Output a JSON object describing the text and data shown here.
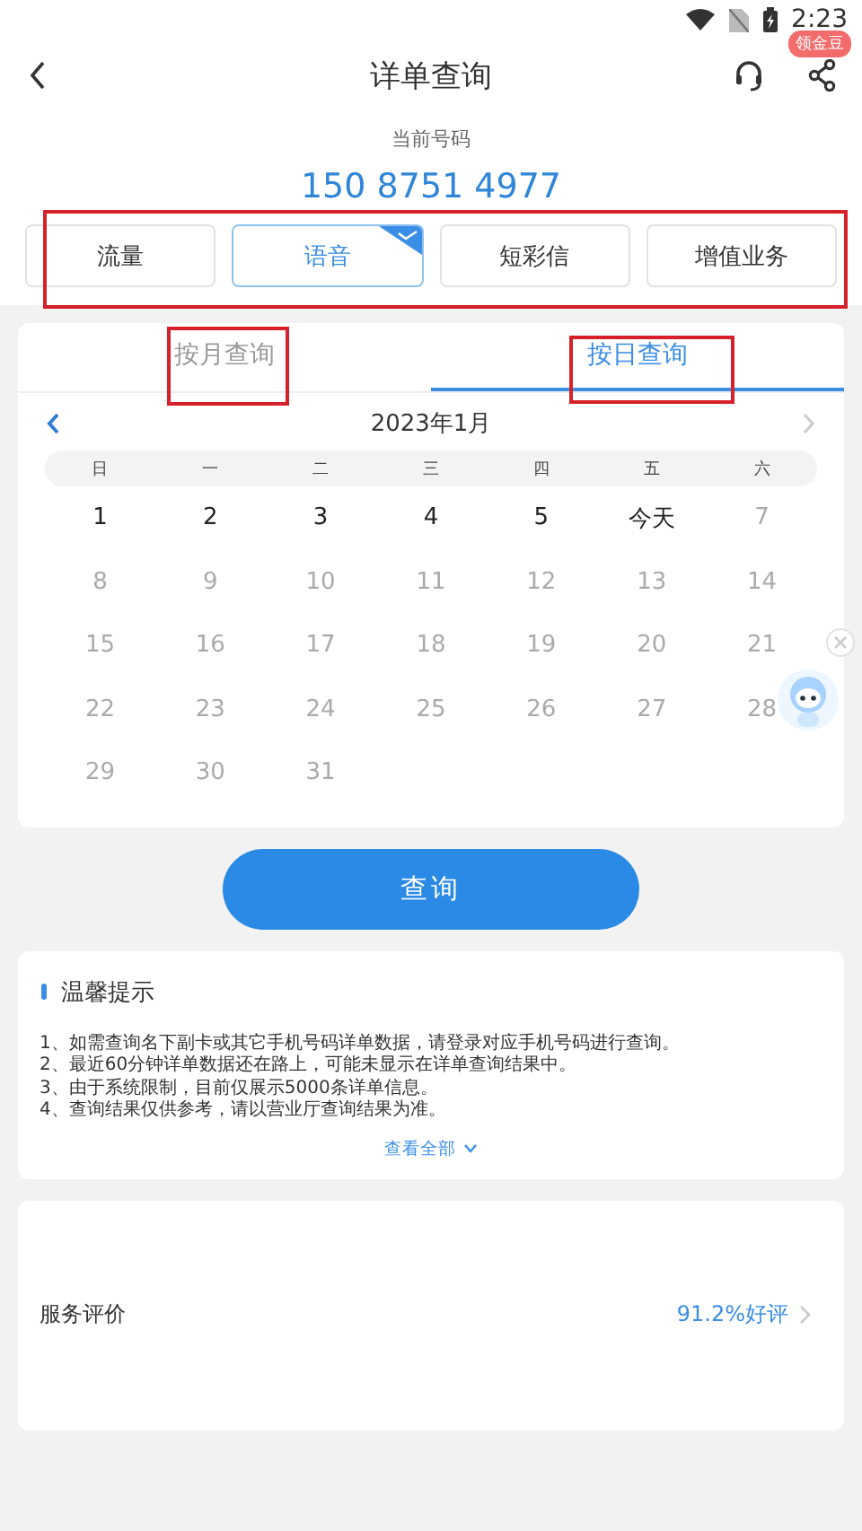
{
  "status_bar": {
    "time": "2:23"
  },
  "header": {
    "title": "详单查询",
    "badge": "领金豆"
  },
  "number_label": "当前号码",
  "phone_number": "150 8751 4977",
  "categories": [
    {
      "label": "流量",
      "selected": false
    },
    {
      "label": "语音",
      "selected": true
    },
    {
      "label": "短彩信",
      "selected": false
    },
    {
      "label": "增值业务",
      "selected": false
    }
  ],
  "query_tabs": [
    {
      "label": "按月查询",
      "selected": false
    },
    {
      "label": "按日查询",
      "selected": true
    }
  ],
  "calendar": {
    "month": "2023年1月",
    "weekdays": [
      "日",
      "一",
      "二",
      "三",
      "四",
      "五",
      "六"
    ],
    "days": [
      {
        "label": "1",
        "disabled": false
      },
      {
        "label": "2",
        "disabled": false
      },
      {
        "label": "3",
        "disabled": false
      },
      {
        "label": "4",
        "disabled": false
      },
      {
        "label": "5",
        "disabled": false
      },
      {
        "label": "今天",
        "disabled": false
      },
      {
        "label": "7",
        "disabled": true
      },
      {
        "label": "8",
        "disabled": true
      },
      {
        "label": "9",
        "disabled": true
      },
      {
        "label": "10",
        "disabled": true
      },
      {
        "label": "11",
        "disabled": true
      },
      {
        "label": "12",
        "disabled": true
      },
      {
        "label": "13",
        "disabled": true
      },
      {
        "label": "14",
        "disabled": true
      },
      {
        "label": "15",
        "disabled": true
      },
      {
        "label": "16",
        "disabled": true
      },
      {
        "label": "17",
        "disabled": true
      },
      {
        "label": "18",
        "disabled": true
      },
      {
        "label": "19",
        "disabled": true
      },
      {
        "label": "20",
        "disabled": true
      },
      {
        "label": "21",
        "disabled": true
      },
      {
        "label": "22",
        "disabled": true
      },
      {
        "label": "23",
        "disabled": true
      },
      {
        "label": "24",
        "disabled": true
      },
      {
        "label": "25",
        "disabled": true
      },
      {
        "label": "26",
        "disabled": true
      },
      {
        "label": "27",
        "disabled": true
      },
      {
        "label": "28",
        "disabled": true
      },
      {
        "label": "29",
        "disabled": true
      },
      {
        "label": "30",
        "disabled": true
      },
      {
        "label": "31",
        "disabled": true
      }
    ]
  },
  "query_button": "查询",
  "tips": {
    "title": "温馨提示",
    "items": [
      "1、如需查询名下副卡或其它手机号码详单数据，请登录对应手机号码进行查询。",
      "2、最近60分钟详单数据还在路上，可能未显示在详单查询结果中。",
      "3、由于系统限制，目前仅展示5000条详单信息。",
      "4、查询结果仅供参考，请以营业厅查询结果为准。"
    ],
    "more": "查看全部"
  },
  "rating": {
    "label": "服务评价",
    "value": "91.2%好评"
  }
}
